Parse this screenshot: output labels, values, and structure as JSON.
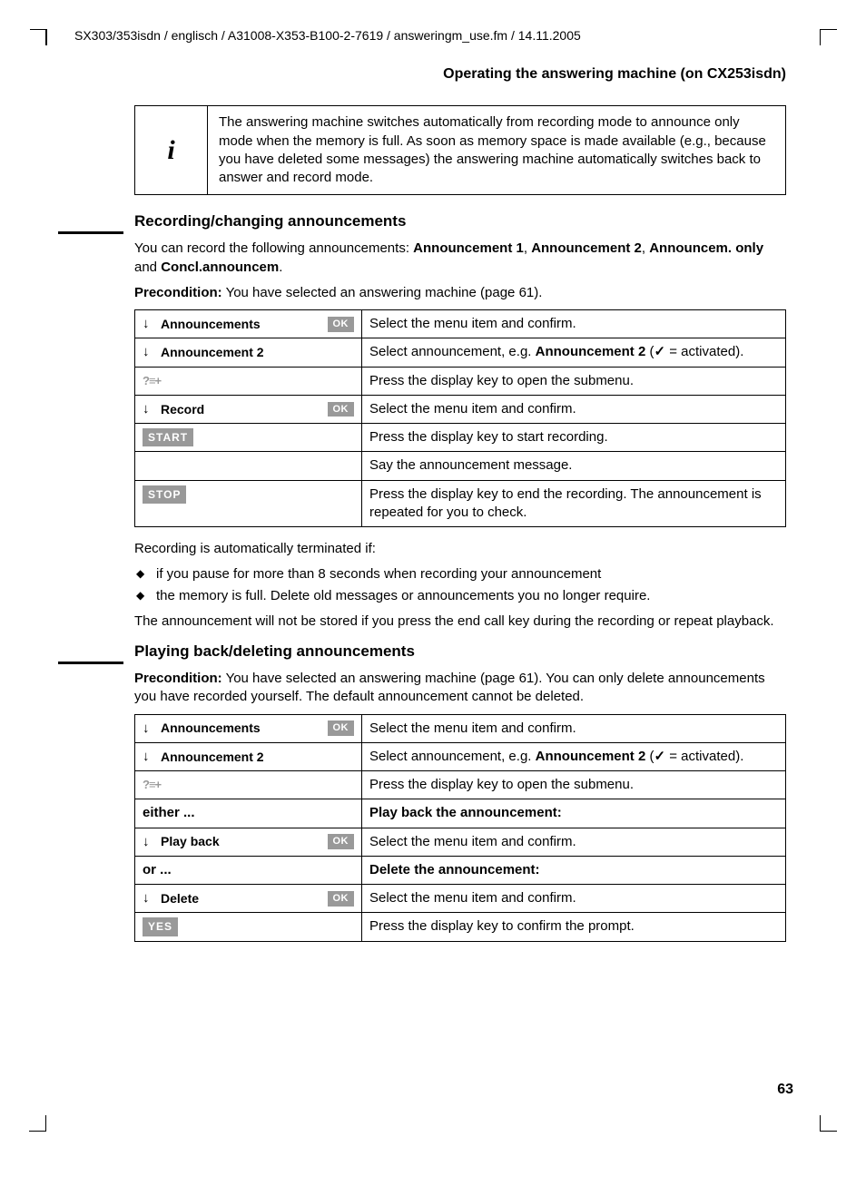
{
  "header_path": "SX303/353isdn / englisch / A31008-X353-B100-2-7619 / answeringm_use.fm / 14.11.2005",
  "section_title_right": "Operating the answering machine   (on CX253isdn)",
  "info_icon": "i",
  "info_text": "The answering machine switches automatically from recording mode to announce only mode when the memory is full. As soon as memory space is made available (e.g., because you have deleted some messages) the answering machine automatically switches back to answer and record mode.",
  "s1": {
    "heading": "Recording/changing announcements",
    "intro_a": "You can record the following announcements: ",
    "intro_b1": "Announcement 1",
    "intro_b2": "Announcement 2",
    "intro_b3": "Announcem. only",
    "intro_b4": "Concl.announcem",
    "precond_label": "Precondition:",
    "precond_text": " You have selected an answering machine (page 61).",
    "rows": [
      {
        "type": "menu",
        "label": "Announcements",
        "ok": true,
        "desc": "Select the menu item and confirm."
      },
      {
        "type": "menu",
        "label": "Announcement 2",
        "ok": false,
        "desc_a": "Select announcement, e.g. ",
        "desc_bold": "Announcement 2",
        "desc_b": " (",
        "desc_c": " = activated)."
      },
      {
        "type": "submenu",
        "desc": "Press the display key to open the submenu."
      },
      {
        "type": "menu",
        "label": "Record",
        "ok": true,
        "desc": "Select the menu item and confirm."
      },
      {
        "type": "badge",
        "label": "START",
        "desc": "Press the display key to start recording."
      },
      {
        "type": "blank",
        "desc": "Say the announcement message."
      },
      {
        "type": "badge",
        "label": "STOP",
        "desc": "Press the display key to end the recording. The announcement is repeated for you to check."
      }
    ],
    "tail_1": "Recording is automatically terminated if:",
    "bullets": [
      "if you pause for more than 8 seconds when recording your announcement",
      "the memory is full. Delete old messages or announcements you no longer require."
    ],
    "tail_2": "The announcement will not be stored if you press the end call key during the recording or repeat playback."
  },
  "s2": {
    "heading": "Playing back/deleting announcements",
    "precond_label": "Precondition:",
    "precond_text": " You have selected an answering machine (page 61). You can only delete announcements you have recorded yourself. The default announcement cannot be deleted.",
    "rows": [
      {
        "type": "menu",
        "label": "Announcements",
        "ok": true,
        "desc": "Select the menu item and confirm."
      },
      {
        "type": "menu",
        "label": "Announcement 2",
        "ok": false,
        "desc_a": "Select announcement, e.g. ",
        "desc_bold": "Announcement 2",
        "desc_b": " (",
        "desc_c": " = activated)."
      },
      {
        "type": "submenu",
        "desc": "Press the display key to open the submenu."
      },
      {
        "type": "either",
        "label": "either ...",
        "desc": "Play back the announcement:"
      },
      {
        "type": "menu",
        "label": "Play back",
        "ok": true,
        "desc": "Select the menu item and confirm."
      },
      {
        "type": "either",
        "label": "or ...",
        "desc": "Delete the announcement:"
      },
      {
        "type": "menu",
        "label": "Delete",
        "ok": true,
        "desc": "Select the menu item and confirm."
      },
      {
        "type": "badge",
        "label": "YES",
        "desc": "Press the display key to confirm the prompt."
      }
    ]
  },
  "page_number": "63",
  "labels": {
    "ok": "OK",
    "arrow": "↓",
    "submenu": "?≡+",
    "check": "✓"
  }
}
